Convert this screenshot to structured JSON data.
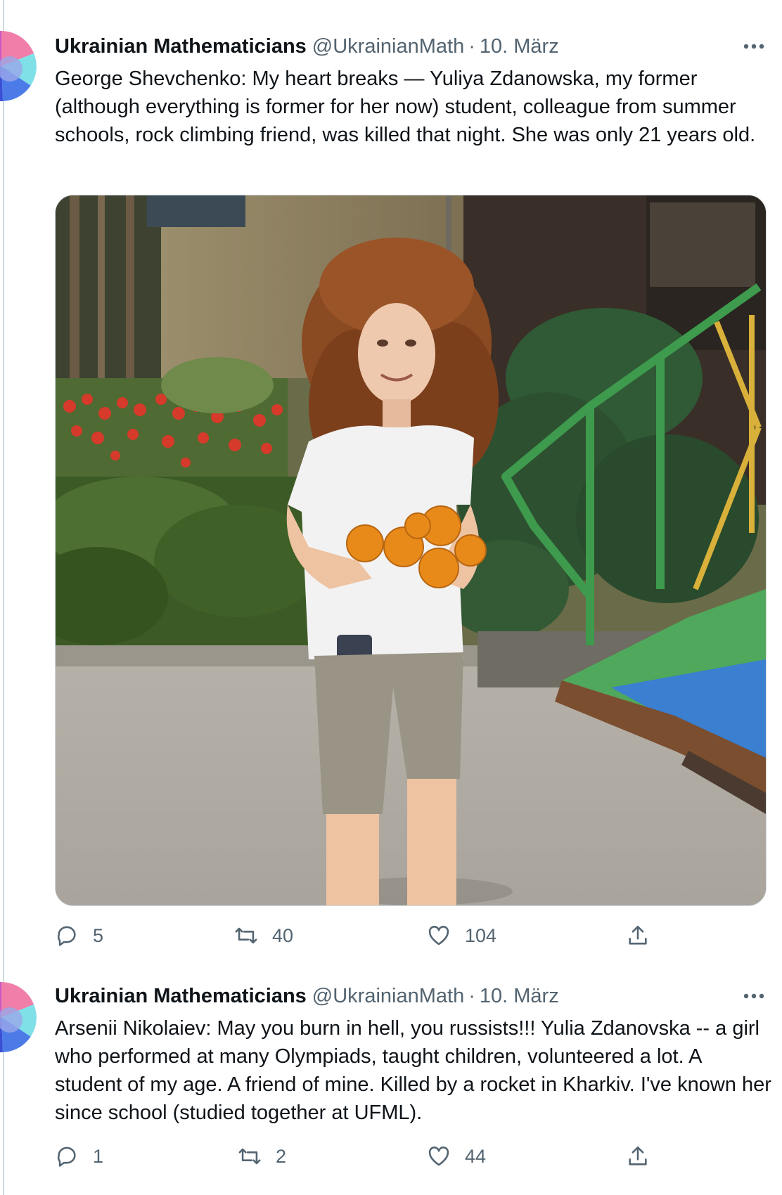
{
  "tweets": [
    {
      "author": {
        "name": "Ukrainian Mathematicians",
        "handle": "@UkrainianMath"
      },
      "separator": "·",
      "date": "10. März",
      "text": "George Shevchenko: My heart breaks — Yuliya Zdanowska, my former (although everything is former for her now) student, colleague from summer schools, rock climbing friend, was killed that night. She was only 21 years old.",
      "stats": {
        "replies": "5",
        "retweets": "40",
        "likes": "104"
      }
    },
    {
      "author": {
        "name": "Ukrainian Mathematicians",
        "handle": "@UkrainianMath"
      },
      "separator": "·",
      "date": "10. März",
      "text": "Arsenii Nikolaiev: May you burn in hell, you russists!!! Yulia Zdanovska -- a girl who performed at many Olympiads, taught children, volunteered a lot. A student of my age. A friend of mine. Killed by a rocket in Kharkiv. I've known her since school (studied together at UFML).",
      "stats": {
        "replies": "1",
        "retweets": "2",
        "likes": "44"
      }
    }
  ],
  "icons": {
    "more": "more-horizontal-icon",
    "reply": "reply-icon",
    "retweet": "retweet-icon",
    "like": "heart-icon",
    "share": "share-icon"
  },
  "colors": {
    "secondary_text": "#536471",
    "border": "#cfd9de"
  }
}
